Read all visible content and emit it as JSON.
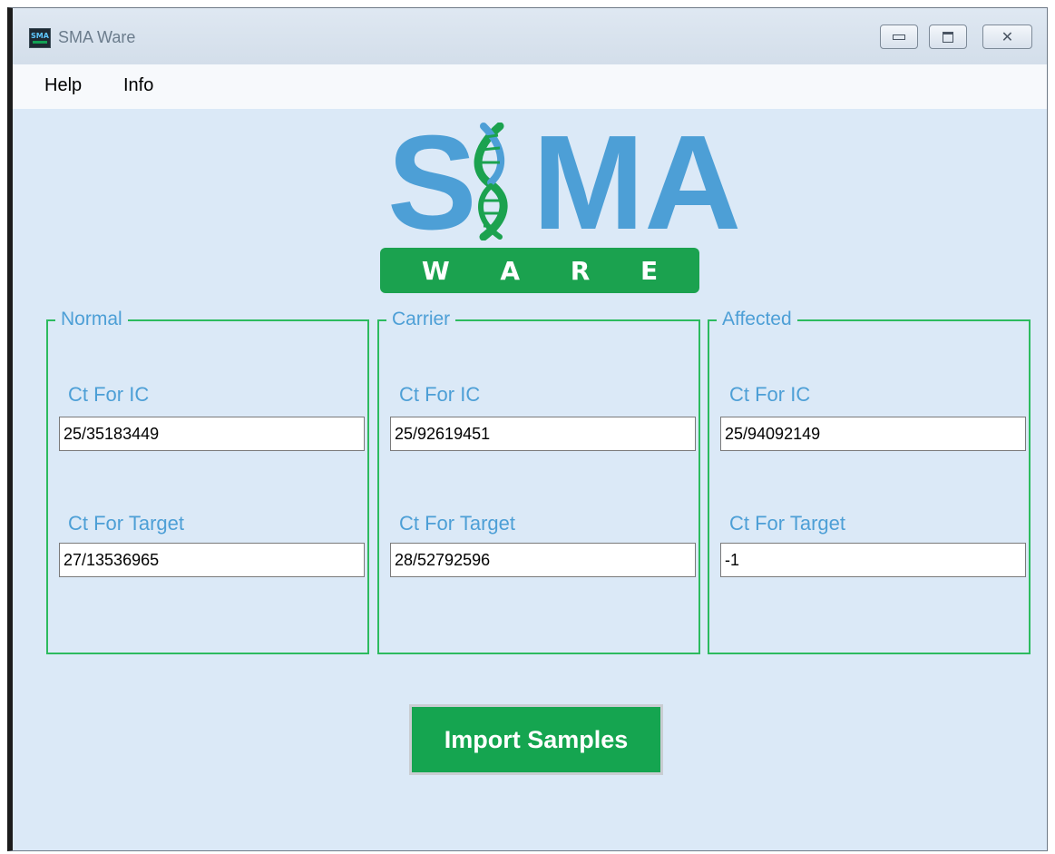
{
  "window": {
    "title": "SMA Ware",
    "icon": "sma-app-icon",
    "icon_text": "SMA",
    "controls": [
      "minimize-icon",
      "maximize-icon",
      "close-icon"
    ]
  },
  "menu": {
    "items": [
      {
        "label": "Help"
      },
      {
        "label": "Info"
      }
    ]
  },
  "logo": {
    "letter_s": "S",
    "letters_ma": "MA",
    "ware_letters": [
      "W",
      "A",
      "R",
      "E"
    ],
    "colors": {
      "primary": "#4d9fd6",
      "accent": "#1ba24f"
    }
  },
  "groups": [
    {
      "title": "Normal",
      "ic_label": "Ct For IC",
      "ic_value": "25/35183449",
      "target_label": "Ct For Target",
      "target_value": "27/13536965"
    },
    {
      "title": "Carrier",
      "ic_label": "Ct For IC",
      "ic_value": "25/92619451",
      "target_label": "Ct For Target",
      "target_value": "28/52792596"
    },
    {
      "title": "Affected",
      "ic_label": "Ct For IC",
      "ic_value": "25/94092149",
      "target_label": "Ct For Target",
      "target_value": "-1"
    }
  ],
  "actions": {
    "import_label": "Import Samples"
  },
  "colors": {
    "background": "#dbe9f7",
    "group_border": "#2dbb5f",
    "label_text": "#4d9fd6",
    "button_bg": "#15a550"
  }
}
